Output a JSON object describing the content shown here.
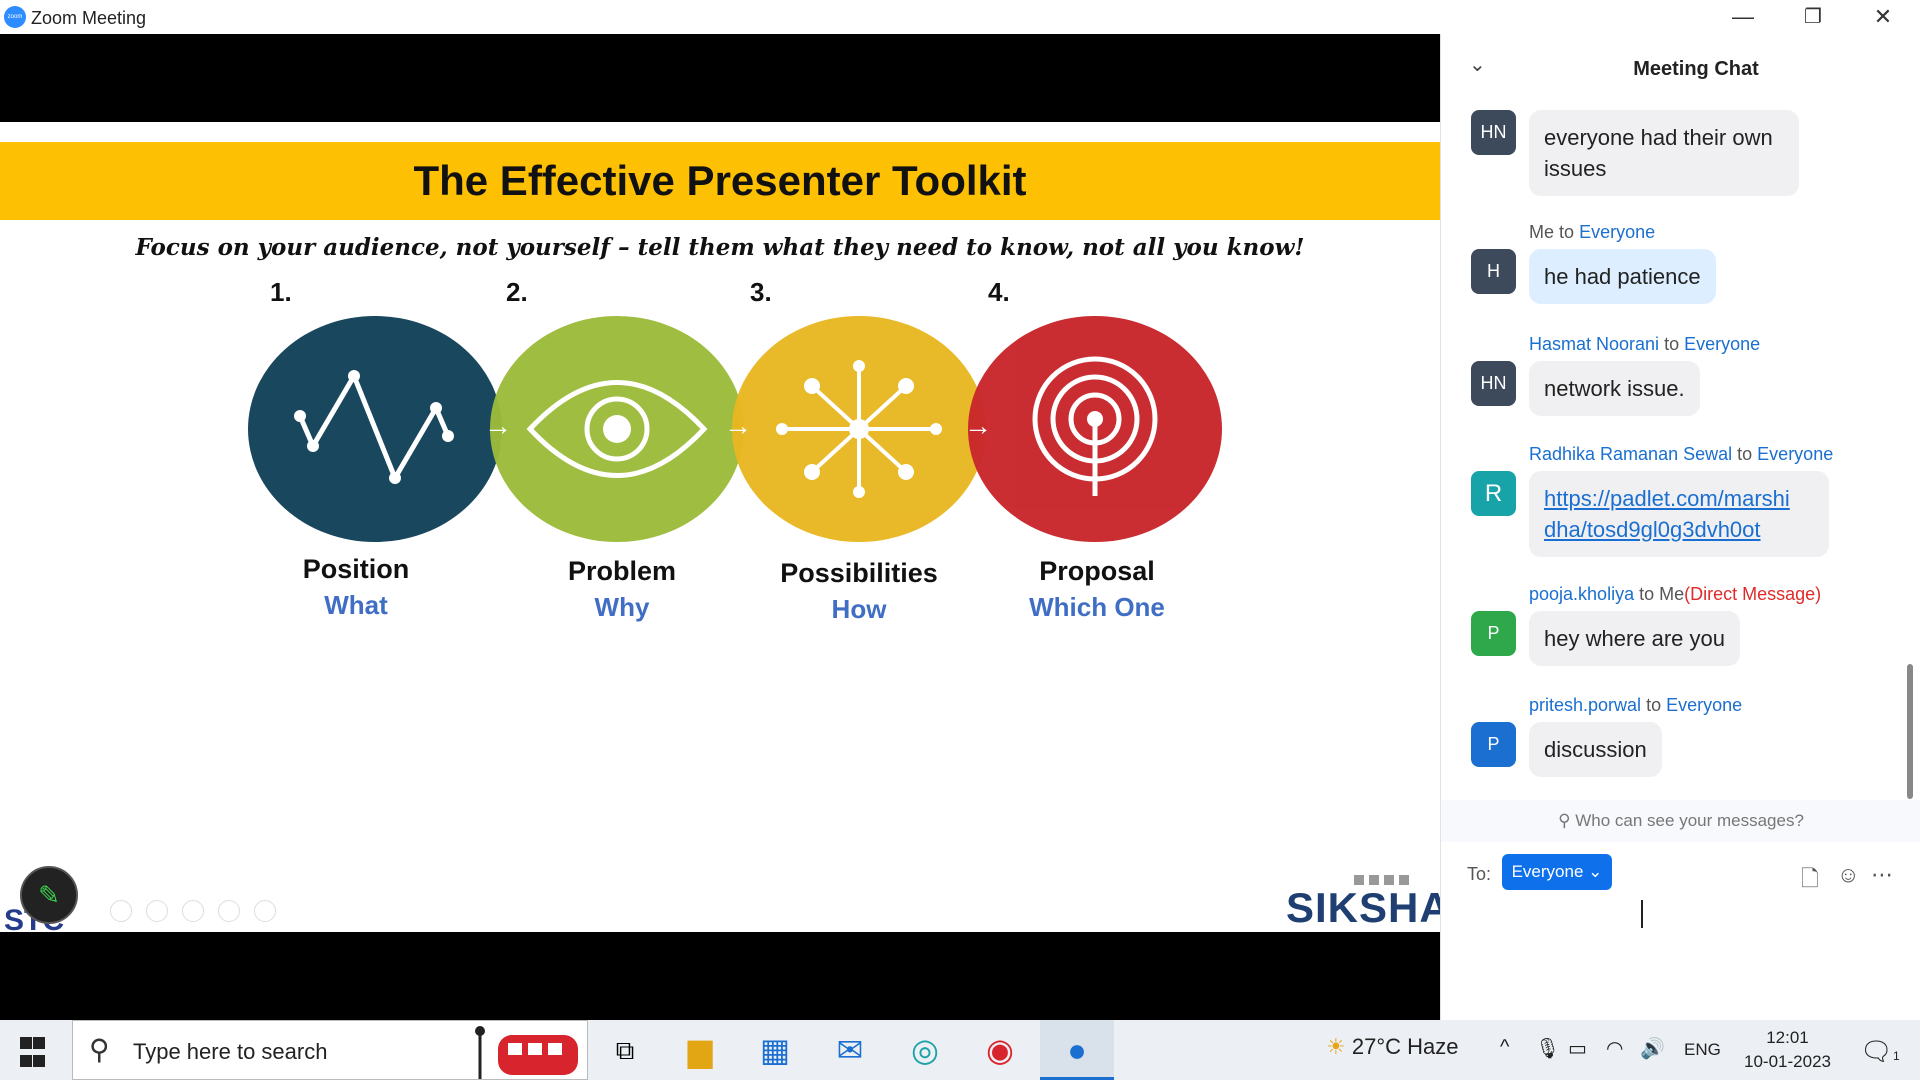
{
  "window": {
    "title": "Zoom Meeting",
    "minimize_icon": "—",
    "restore_icon": "❐",
    "close_icon": "✕"
  },
  "slide": {
    "title": "The Effective Presenter Toolkit",
    "subtitle": "Focus on your audience, not  yourself – tell them what they need to know, not all you know!",
    "steps": [
      {
        "num": "1.",
        "label": "Position",
        "sub": "What",
        "color": "#19475e"
      },
      {
        "num": "2.",
        "label": "Problem",
        "sub": "Why",
        "color": "#9cbb3b"
      },
      {
        "num": "3.",
        "label": "Possibilities",
        "sub": "How",
        "color": "#e8b722"
      },
      {
        "num": "4.",
        "label": "Proposal",
        "sub": "Which One",
        "color": "#c8262b"
      }
    ],
    "logo_right": "SIKSHA",
    "logo_left": "STC"
  },
  "chat": {
    "title": "Meeting Chat",
    "messages": [
      {
        "initials": "HN",
        "sender": "",
        "to": "",
        "text": "everyone had their own issues",
        "avatar_color": "#3d4a5c"
      },
      {
        "initials": "H",
        "sender": "Me",
        "to_word": "to",
        "to": "Everyone",
        "text": "he had patience",
        "avatar_color": "#3d4a5c"
      },
      {
        "initials": "HN",
        "sender": "Hasmat Noorani",
        "to_word": "to",
        "to": "Everyone",
        "text": "network issue.",
        "avatar_color": "#3d4a5c"
      },
      {
        "initials": "R",
        "sender": "Radhika Ramanan Sewal",
        "to_word": "to",
        "to": "Everyone",
        "text": "https://padlet.com/marshidha/tosd9gl0g3dvh0ot",
        "text_line1": "https://padlet.com/marshi",
        "text_line2": "dha/tosd9gl0g3dvh0ot",
        "avatar_color": "#17a3a8"
      },
      {
        "initials": "P",
        "sender": "pooja.kholiya",
        "to_word": "to",
        "to": "Me",
        "direct": "(Direct Message)",
        "text": "hey where are you",
        "avatar_color": "#2ea84a"
      },
      {
        "initials": "P",
        "sender": "pritesh.porwal",
        "to_word": "to",
        "to": "Everyone",
        "text": "discussion",
        "avatar_color": "#1a6fd0"
      }
    ],
    "privacy_text": "Who can see your messages?",
    "to_label": "To:",
    "to_value": "Everyone"
  },
  "taskbar": {
    "search_placeholder": "Type here to search",
    "weather": "27°C  Haze",
    "language": "ENG",
    "time": "12:01",
    "date": "10-01-2023",
    "notifications": "1"
  }
}
